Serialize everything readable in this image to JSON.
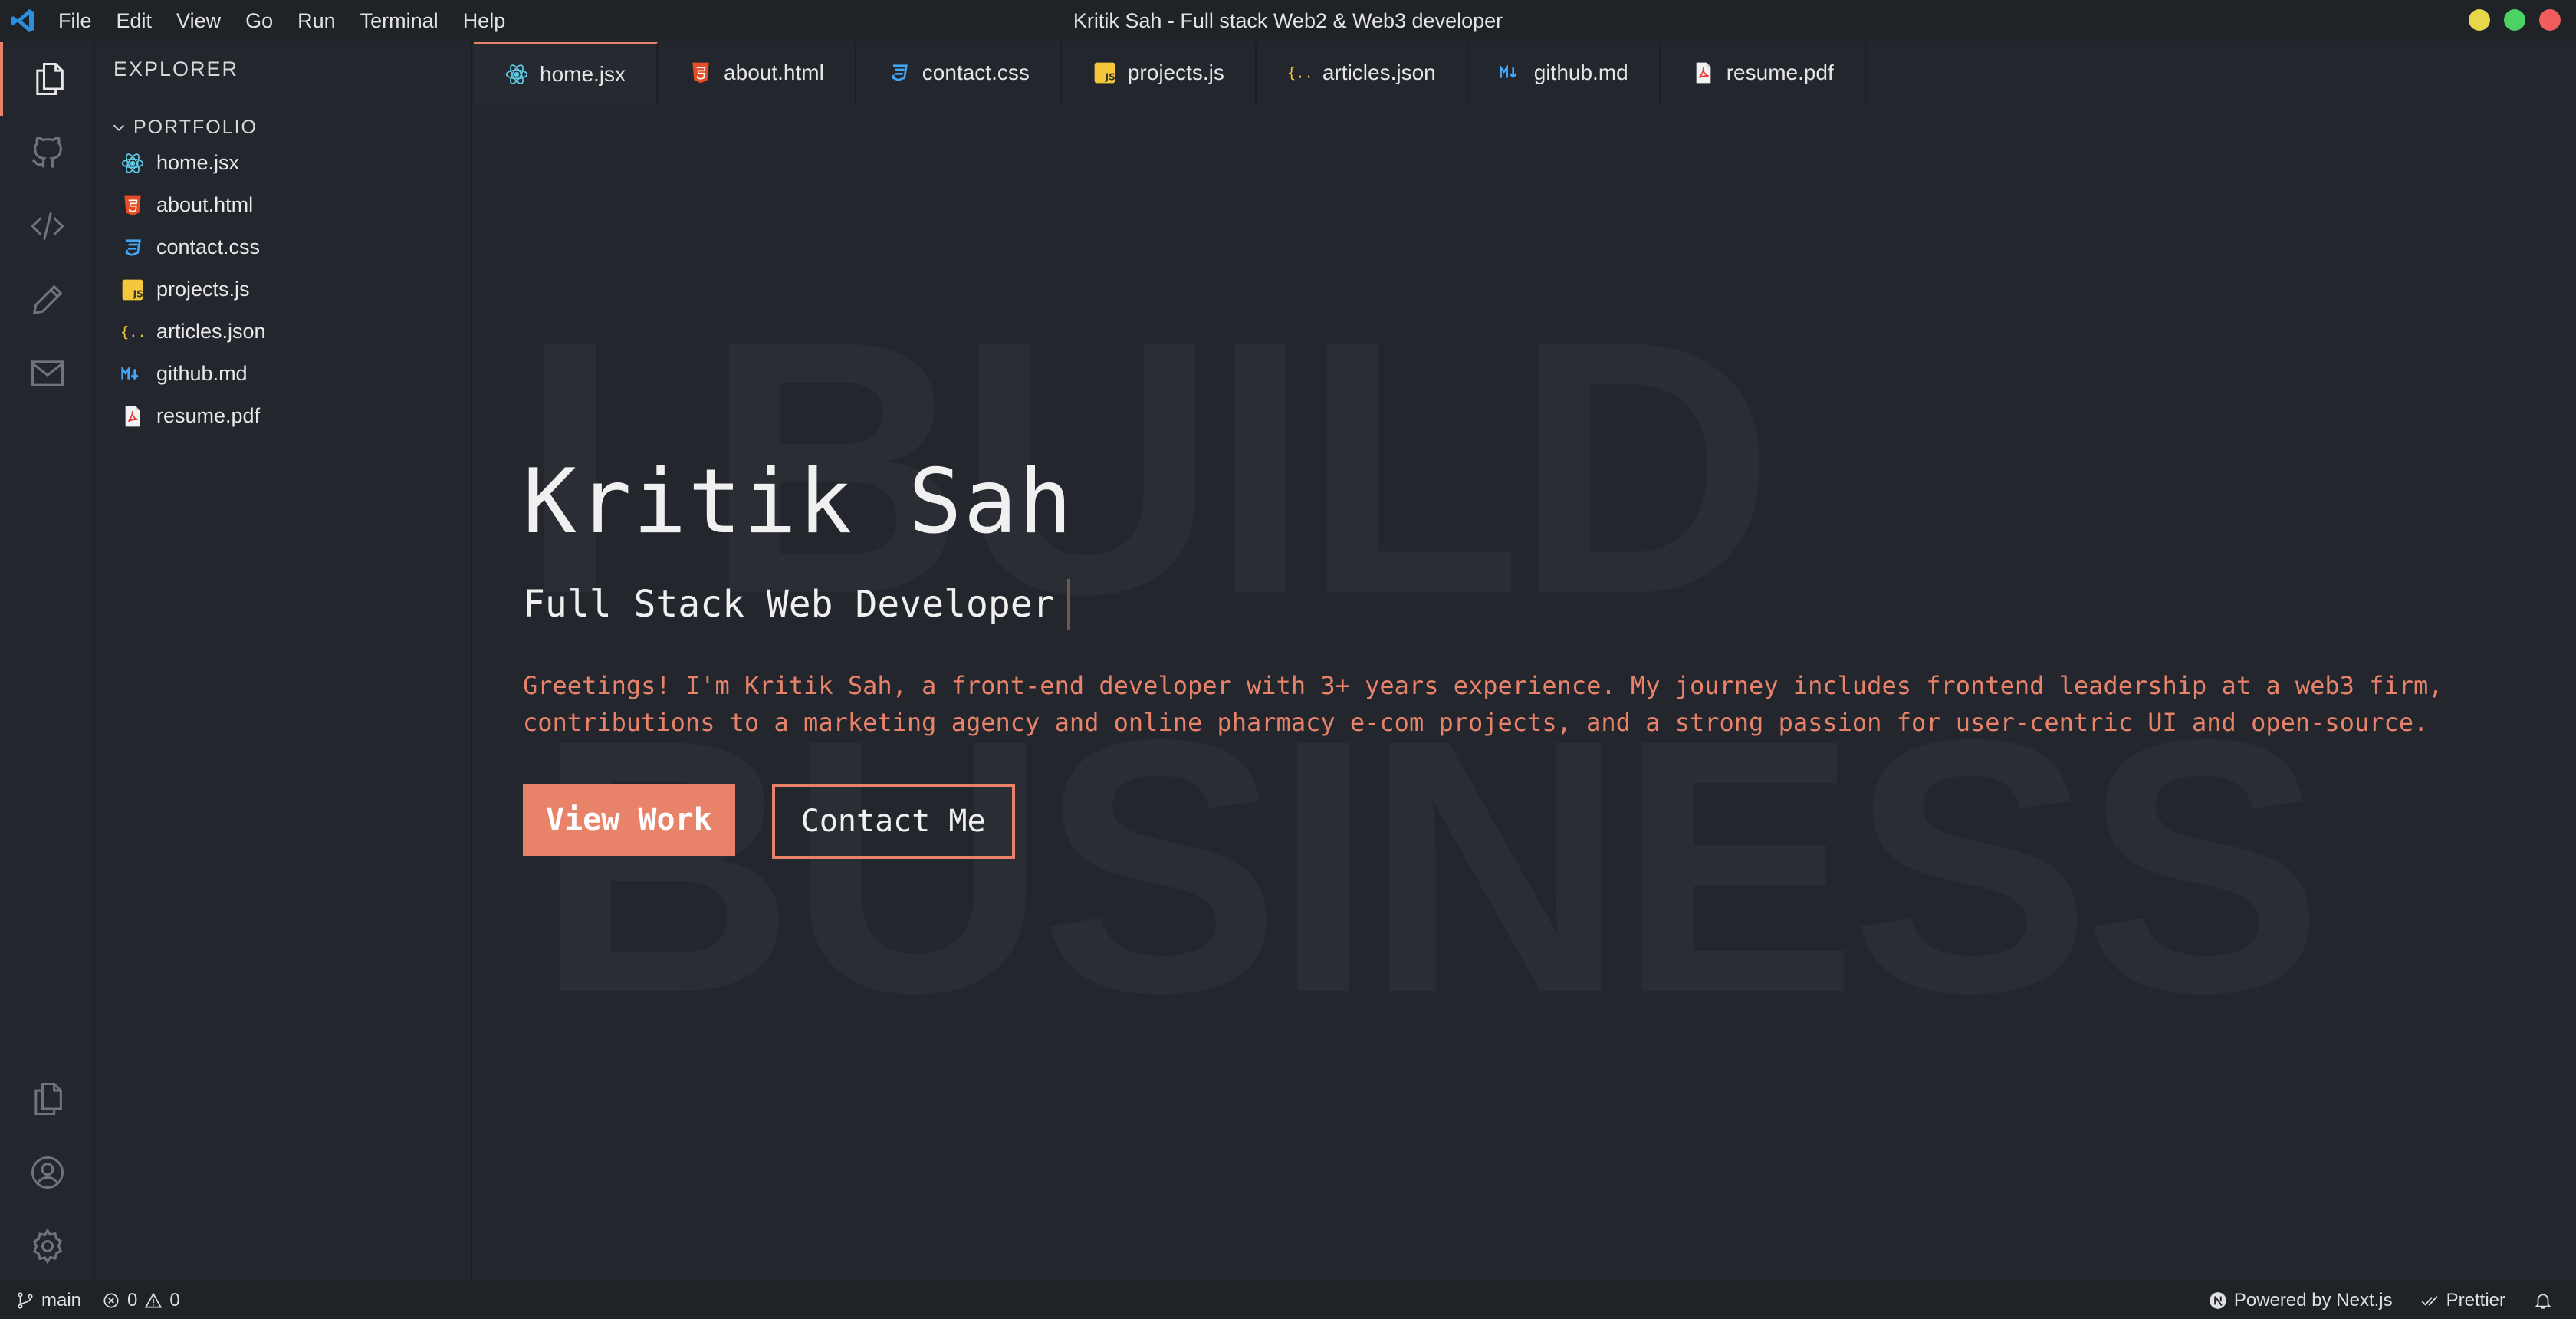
{
  "titlebar": {
    "title": "Kritik Sah - Full stack Web2 & Web3 developer",
    "menu": [
      "File",
      "Edit",
      "View",
      "Go",
      "Run",
      "Terminal",
      "Help"
    ]
  },
  "sidebar": {
    "title": "EXPLORER",
    "folder": "PORTFOLIO",
    "files": [
      {
        "name": "home.jsx",
        "icon": "react-icon"
      },
      {
        "name": "about.html",
        "icon": "html-icon"
      },
      {
        "name": "contact.css",
        "icon": "css-icon"
      },
      {
        "name": "projects.js",
        "icon": "js-icon"
      },
      {
        "name": "articles.json",
        "icon": "json-icon"
      },
      {
        "name": "github.md",
        "icon": "markdown-icon"
      },
      {
        "name": "resume.pdf",
        "icon": "pdf-icon"
      }
    ]
  },
  "tabs": [
    {
      "label": "home.jsx",
      "active": true
    },
    {
      "label": "about.html"
    },
    {
      "label": "contact.css"
    },
    {
      "label": "projects.js"
    },
    {
      "label": "articles.json"
    },
    {
      "label": "github.md"
    },
    {
      "label": "resume.pdf"
    }
  ],
  "hero": {
    "background_line1": "I BUILD",
    "background_line2": "BUSINESS",
    "name": "Kritik Sah",
    "role": "Full Stack Web Developer",
    "description": "Greetings! I'm Kritik Sah, a front-end developer with 3+ years experience. My journey includes frontend leadership at a web3 firm, contributions to a marketing agency and online pharmacy e-com projects, and a strong passion for user-centric UI and open-source.",
    "primary_button": "View Work",
    "secondary_button": "Contact Me"
  },
  "statusbar": {
    "branch": "main",
    "errors": "0",
    "warnings": "0",
    "powered_by": "Powered by Next.js",
    "prettier": "Prettier"
  },
  "colors": {
    "accent": "#e8836a",
    "background": "#23262c",
    "titlebar": "#1f2227"
  }
}
